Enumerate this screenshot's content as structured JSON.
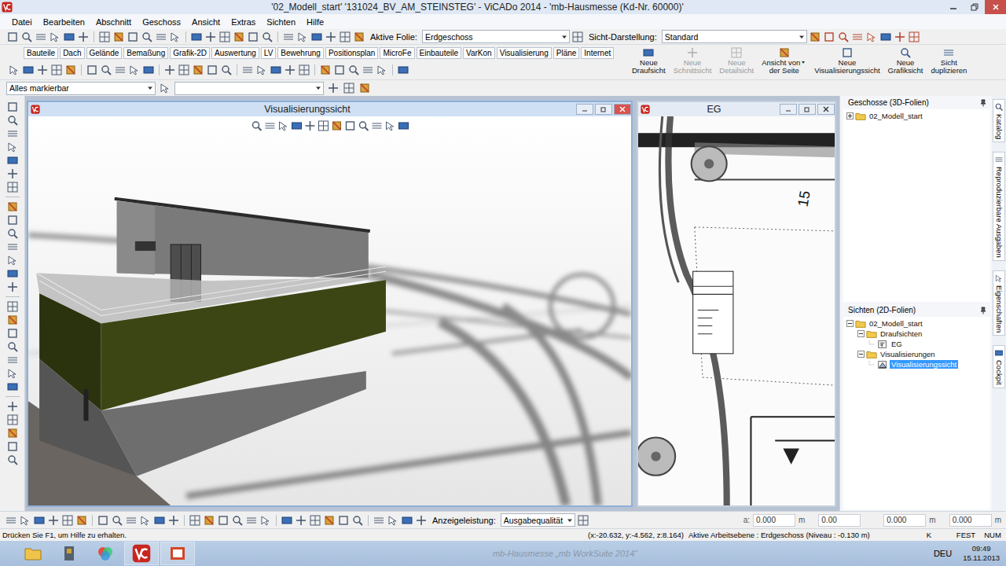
{
  "window": {
    "title": "'02_Modell_start' '131024_BV_AM_STEINSTEG' - ViCADo 2014 - 'mb-Hausmesse (Kd-Nr. 60000)'"
  },
  "menu": [
    "Datei",
    "Bearbeiten",
    "Abschnitt",
    "Geschoss",
    "Ansicht",
    "Extras",
    "Sichten",
    "Hilfe"
  ],
  "toolbar": {
    "active_layer_label": "Aktive Folie:",
    "active_layer": "Erdgeschoss",
    "view_mode_label": "Sicht-Darstellung:",
    "view_mode": "Standard"
  },
  "ribbon_tabs": [
    "Bauteile",
    "Dach",
    "Gelände",
    "Bemaßung",
    "Grafik-2D",
    "Auswertung",
    "LV",
    "Bewehrung",
    "Positionsplan",
    "MicroFe",
    "Einbauteile",
    "VarKon",
    "Visualisierung",
    "Pläne",
    "Internet"
  ],
  "view_buttons": [
    {
      "lines": [
        "Neue",
        "Draufsicht"
      ],
      "disabled": false,
      "dropdown": false
    },
    {
      "lines": [
        "Neue",
        "Schnittsicht"
      ],
      "disabled": true,
      "dropdown": false
    },
    {
      "lines": [
        "Neue",
        "Detailsicht"
      ],
      "disabled": true,
      "dropdown": false
    },
    {
      "lines": [
        "Ansicht von",
        "der Seite"
      ],
      "disabled": false,
      "dropdown": true
    },
    {
      "lines": [
        "Neue",
        "Visualisierungssicht"
      ],
      "disabled": false,
      "dropdown": false
    },
    {
      "lines": [
        "Neue",
        "Grafiksicht"
      ],
      "disabled": false,
      "dropdown": false
    },
    {
      "lines": [
        "Sicht",
        "duplizieren"
      ],
      "disabled": false,
      "dropdown": false
    }
  ],
  "selection_filter": "Alles markierbar",
  "windows": [
    {
      "title": "Visualisierungssicht",
      "active": true
    },
    {
      "title": "EG",
      "active": false
    }
  ],
  "plan_labels": [
    "15"
  ],
  "floors_panel": {
    "title": "Geschosse (3D-Folien)",
    "tree": [
      {
        "label": "02_Modell_start",
        "kind": "folder",
        "depth": 0,
        "expanded": false,
        "selected": false
      }
    ]
  },
  "views_panel": {
    "title": "Sichten (2D-Folien)",
    "tree": [
      {
        "label": "02_Modell_start",
        "kind": "folder",
        "depth": 0,
        "expanded": true,
        "selected": false
      },
      {
        "label": "Draufsichten",
        "kind": "folder",
        "depth": 1,
        "expanded": true,
        "selected": false
      },
      {
        "label": "EG",
        "kind": "plan",
        "depth": 2,
        "selected": false
      },
      {
        "label": "Visualisierungen",
        "kind": "folder",
        "depth": 1,
        "expanded": true,
        "selected": false
      },
      {
        "label": "Visualisierungssicht",
        "kind": "visual",
        "depth": 2,
        "selected": true
      }
    ]
  },
  "side_tabs": [
    "Katalog",
    "Reproduzierbare Ausgaben",
    "Eigenschaften",
    "Cockpit"
  ],
  "bottom_toolbar": {
    "performance_label": "Anzeigeleistung:",
    "performance": "Ausgabequalität",
    "fields": [
      {
        "label": "a:",
        "value": "0.000",
        "unit": "m"
      },
      {
        "label": "",
        "value": "0.00",
        "unit": ""
      },
      {
        "label": "",
        "value": "0.000",
        "unit": "m"
      },
      {
        "label": "",
        "value": "0.000",
        "unit": "m"
      }
    ]
  },
  "status_bar": {
    "hint": "Drücken Sie F1, um Hilfe zu erhalten.",
    "coords": "(x:-20.632, y:-4.562, z:8.164)",
    "work_plane": "Aktive Arbeitsebene : Erdgeschoss (Niveau : -0.130 m)",
    "indicators": [
      "K",
      "FEST",
      "NUM"
    ]
  },
  "taskbar": {
    "caption": "mb-Hausmesse „mb WorkSuite 2014“",
    "language": "DEU",
    "time": "09:49",
    "date": "15.11.2013"
  }
}
